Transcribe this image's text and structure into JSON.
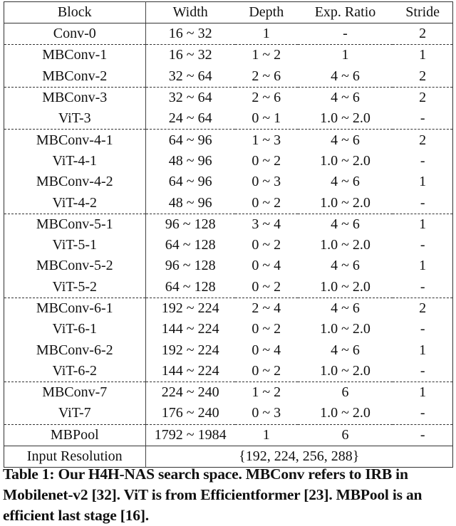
{
  "table": {
    "headers": [
      "Block",
      "Width",
      "Depth",
      "Exp. Ratio",
      "Stride"
    ],
    "rows": [
      {
        "block": "Conv-0",
        "width": "16 ~ 32",
        "depth": "1",
        "ratio": "-",
        "stride": "2",
        "group_start": false
      },
      {
        "block": "MBConv-1",
        "width": "16 ~ 32",
        "depth": "1 ~ 2",
        "ratio": "1",
        "stride": "1",
        "group_start": true
      },
      {
        "block": "MBConv-2",
        "width": "32 ~ 64",
        "depth": "2 ~ 6",
        "ratio": "4 ~ 6",
        "stride": "2",
        "group_start": false
      },
      {
        "block": "MBConv-3",
        "width": "32 ~ 64",
        "depth": "2 ~ 6",
        "ratio": "4 ~ 6",
        "stride": "2",
        "group_start": true
      },
      {
        "block": "ViT-3",
        "width": "24 ~ 64",
        "depth": "0 ~ 1",
        "ratio": "1.0 ~ 2.0",
        "stride": "-",
        "group_start": false
      },
      {
        "block": "MBConv-4-1",
        "width": "64 ~ 96",
        "depth": "1 ~ 3",
        "ratio": "4 ~ 6",
        "stride": "2",
        "group_start": true
      },
      {
        "block": "ViT-4-1",
        "width": "48 ~ 96",
        "depth": "0 ~ 2",
        "ratio": "1.0 ~ 2.0",
        "stride": "-",
        "group_start": false
      },
      {
        "block": "MBConv-4-2",
        "width": "64 ~ 96",
        "depth": "0 ~ 3",
        "ratio": "4 ~ 6",
        "stride": "1",
        "group_start": false
      },
      {
        "block": "ViT-4-2",
        "width": "48 ~ 96",
        "depth": "0 ~ 2",
        "ratio": "1.0 ~ 2.0",
        "stride": "-",
        "group_start": false
      },
      {
        "block": "MBConv-5-1",
        "width": "96 ~ 128",
        "depth": "3 ~ 4",
        "ratio": "4 ~ 6",
        "stride": "1",
        "group_start": true
      },
      {
        "block": "ViT-5-1",
        "width": "64 ~ 128",
        "depth": "0 ~ 2",
        "ratio": "1.0 ~ 2.0",
        "stride": "-",
        "group_start": false
      },
      {
        "block": "MBConv-5-2",
        "width": "96 ~ 128",
        "depth": "0 ~ 4",
        "ratio": "4 ~ 6",
        "stride": "1",
        "group_start": false
      },
      {
        "block": "ViT-5-2",
        "width": "64 ~ 128",
        "depth": "0 ~ 2",
        "ratio": "1.0 ~ 2.0",
        "stride": "-",
        "group_start": false
      },
      {
        "block": "MBConv-6-1",
        "width": "192 ~ 224",
        "depth": "2 ~ 4",
        "ratio": "4 ~ 6",
        "stride": "2",
        "group_start": true
      },
      {
        "block": "ViT-6-1",
        "width": "144 ~ 224",
        "depth": "0 ~ 2",
        "ratio": "1.0 ~ 2.0",
        "stride": "-",
        "group_start": false
      },
      {
        "block": "MBConv-6-2",
        "width": "192 ~ 224",
        "depth": "0 ~ 4",
        "ratio": "4 ~ 6",
        "stride": "1",
        "group_start": false
      },
      {
        "block": "ViT-6-2",
        "width": "144 ~ 224",
        "depth": "0 ~ 2",
        "ratio": "1.0 ~ 2.0",
        "stride": "-",
        "group_start": false
      },
      {
        "block": "MBConv-7",
        "width": "224 ~ 240",
        "depth": "1 ~ 2",
        "ratio": "6",
        "stride": "1",
        "group_start": true
      },
      {
        "block": "ViT-7",
        "width": "176 ~ 240",
        "depth": "0 ~ 3",
        "ratio": "1.0 ~ 2.0",
        "stride": "-",
        "group_start": false
      },
      {
        "block": "MBPool",
        "width": "1792 ~ 1984",
        "depth": "1",
        "ratio": "6",
        "stride": "-",
        "group_start": true
      }
    ],
    "footer": {
      "label": "Input Resolution",
      "value": "{192, 224, 256, 288}"
    }
  },
  "caption": "Table 1: Our H4H-NAS search space. MBConv refers to IRB in Mobilenet-v2 [32]. ViT is from Efficientformer [23]. MBPool is an efficient last stage [16]."
}
